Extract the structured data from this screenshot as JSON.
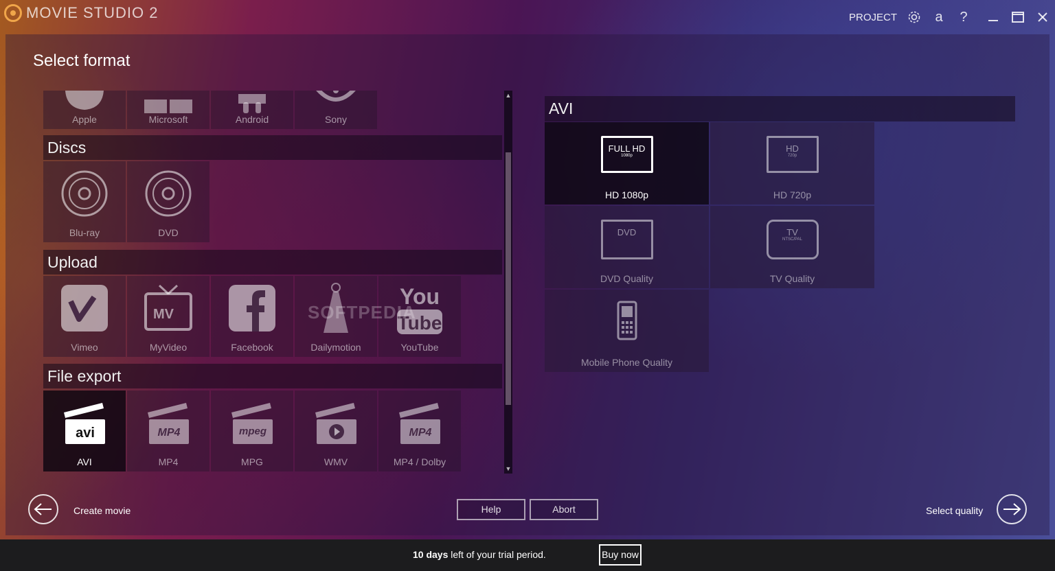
{
  "app": {
    "logo_text": "MOVIE STUDIO 2"
  },
  "titlebar": {
    "project_label": "PROJECT",
    "icons": [
      "gear-icon",
      "account-icon",
      "help-icon"
    ],
    "account_glyph": "a",
    "help_glyph": "?",
    "window_controls": [
      "minimize",
      "maximize",
      "close"
    ]
  },
  "page_title": "Select format",
  "categories": {
    "devices": {
      "items": [
        "Apple",
        "Microsoft",
        "Android",
        "Sony"
      ]
    },
    "discs": {
      "title": "Discs",
      "items": [
        "Blu-ray",
        "DVD"
      ]
    },
    "upload": {
      "title": "Upload",
      "items": [
        "Vimeo",
        "MyVideo",
        "Facebook",
        "Dailymotion",
        "YouTube"
      ]
    },
    "file_export": {
      "title": "File export",
      "items": [
        "AVI",
        "MP4",
        "MPG",
        "WMV",
        "MP4 / Dolby"
      ],
      "selected": "AVI"
    }
  },
  "format_panel": {
    "title": "AVI",
    "qualities": [
      {
        "label": "HD 1080p",
        "screen_main": "FULL HD",
        "screen_sub": "1080p",
        "selected": true
      },
      {
        "label": "HD 720p",
        "screen_main": "HD",
        "screen_sub": "720p",
        "selected": false
      },
      {
        "label": "DVD Quality",
        "screen_main": "DVD",
        "screen_sub": "",
        "selected": false
      },
      {
        "label": "TV Quality",
        "screen_main": "TV",
        "screen_sub": "NTSC/PAL",
        "selected": false
      },
      {
        "label": "Mobile Phone Quality",
        "screen_main": "",
        "screen_sub": "",
        "selected": false
      }
    ]
  },
  "icon_texts": {
    "avi": "avi",
    "mp4": "MP4",
    "mpeg": "mpeg",
    "mv": "MV",
    "you": "You",
    "tube": "Tube"
  },
  "nav": {
    "back_label": "Create movie",
    "help_label": "Help",
    "abort_label": "Abort",
    "next_label": "Select quality"
  },
  "trial": {
    "days": "10 days",
    "text": " left of your trial period.",
    "buy_label": "Buy now"
  },
  "watermark": "SOFTPEDIA"
}
